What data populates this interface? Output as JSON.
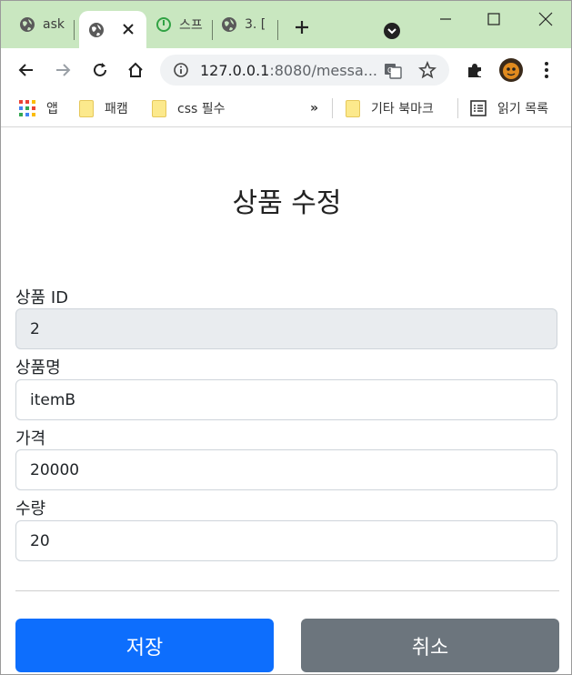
{
  "browser": {
    "tabs": [
      {
        "label": "ask",
        "active": false
      },
      {
        "label": "",
        "active": true
      },
      {
        "label": "스프",
        "active": false
      },
      {
        "label": "3. [",
        "active": false
      }
    ],
    "url": {
      "host": "127.0.0.1",
      "rest": ":8080/messa..."
    },
    "bookmarks": {
      "apps": "앱",
      "items": [
        "패캠",
        "css 필수"
      ],
      "more": "»",
      "other": "기타 북마크",
      "reading_list": "읽기 목록"
    }
  },
  "form": {
    "title": "상품 수정",
    "fields": [
      {
        "label": "상품 ID",
        "value": "2",
        "readonly": true
      },
      {
        "label": "상품명",
        "value": "itemB",
        "readonly": false
      },
      {
        "label": "가격",
        "value": "20000",
        "readonly": false
      },
      {
        "label": "수량",
        "value": "20",
        "readonly": false
      }
    ],
    "save_label": "저장",
    "cancel_label": "취소"
  },
  "colors": {
    "tabstrip": "#c9e7c0",
    "primary": "#0d6efd",
    "secondary": "#6c757d",
    "readonly_bg": "#e9ecef"
  }
}
